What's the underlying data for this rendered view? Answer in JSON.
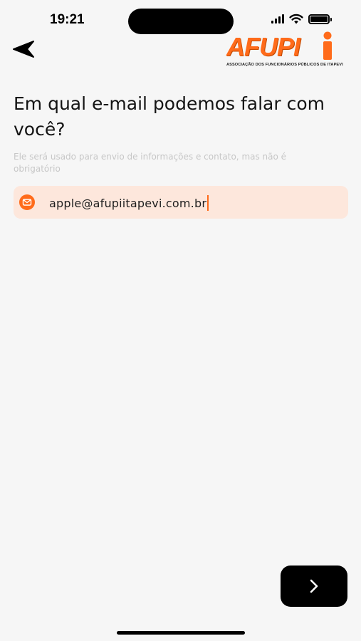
{
  "status_bar": {
    "time": "19:21",
    "icons": [
      "signal-icon",
      "wifi-icon",
      "battery-icon"
    ]
  },
  "header": {
    "back_icon": "back-arrow-icon",
    "logo_text": "AFUPI",
    "logo_subtitle": "ASSOCIAÇÃO DOS FUNCIONÁRIOS PÚBLICOS DE ITAPEVI"
  },
  "main": {
    "headline": "Em qual e-mail podemos falar com você?",
    "helper_text": "Ele será usado para envio de informações e contato, mas não é obrigatório",
    "email_field": {
      "icon": "mail-icon",
      "value": "apple@afupiitapevi.com.br"
    }
  },
  "footer": {
    "next_icon": "chevron-right-icon"
  },
  "colors": {
    "accent": "#ff6b1a",
    "field_background": "#fde7dc",
    "background": "#f6f6f6",
    "button": "#000000"
  }
}
